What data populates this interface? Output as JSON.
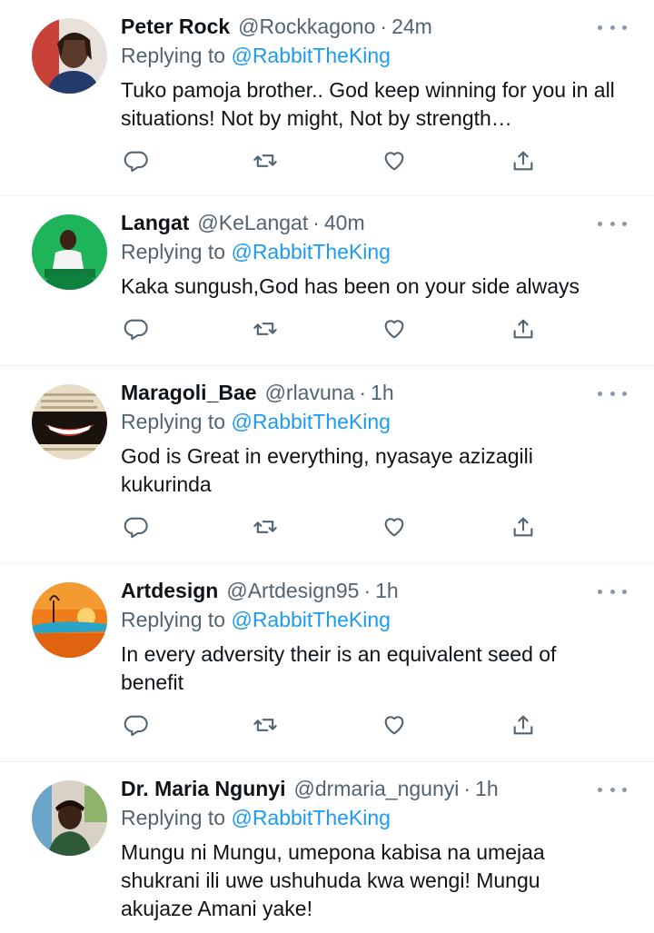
{
  "colors": {
    "accent": "#1d9bf0",
    "secondary_text": "#536471",
    "text": "#0f1419",
    "divider": "#eff3f4"
  },
  "icons": {
    "reply": "reply-icon",
    "retweet": "retweet-icon",
    "like": "heart-icon",
    "share": "share-icon",
    "more": "more-icon"
  },
  "tweets": [
    {
      "name": "Peter Rock",
      "handle": "@Rockkagono",
      "dot": "·",
      "time": "24m",
      "replying_prefix": "Replying to",
      "replying_to": "@RabbitTheKing",
      "text": "Tuko pamoja brother.. God keep winning for you in all situations! Not by might, Not by strength…"
    },
    {
      "name": "Langat",
      "handle": "@KeLangat",
      "dot": "·",
      "time": "40m",
      "replying_prefix": "Replying to",
      "replying_to": "@RabbitTheKing",
      "text": "Kaka sungush,God has been on your side always"
    },
    {
      "name": "Maragoli_Bae",
      "handle": "@rlavuna",
      "dot": "·",
      "time": "1h",
      "replying_prefix": "Replying to",
      "replying_to": "@RabbitTheKing",
      "text": "God is Great in everything, nyasaye azizagili kukurinda"
    },
    {
      "name": "Artdesign",
      "handle": "@Artdesign95",
      "dot": "·",
      "time": "1h",
      "replying_prefix": "Replying to",
      "replying_to": "@RabbitTheKing",
      "text": "In every adversity their is an equivalent seed of benefit"
    },
    {
      "name": "Dr. Maria Ngunyi",
      "handle": "@drmaria_ngunyi",
      "dot": "·",
      "time": "1h",
      "replying_prefix": "Replying to",
      "replying_to": "@RabbitTheKing",
      "text": "Mungu ni Mungu, umepona kabisa na umejaa shukrani ili uwe ushuhuda kwa wengi! Mungu akujaze Amani yake!"
    }
  ]
}
